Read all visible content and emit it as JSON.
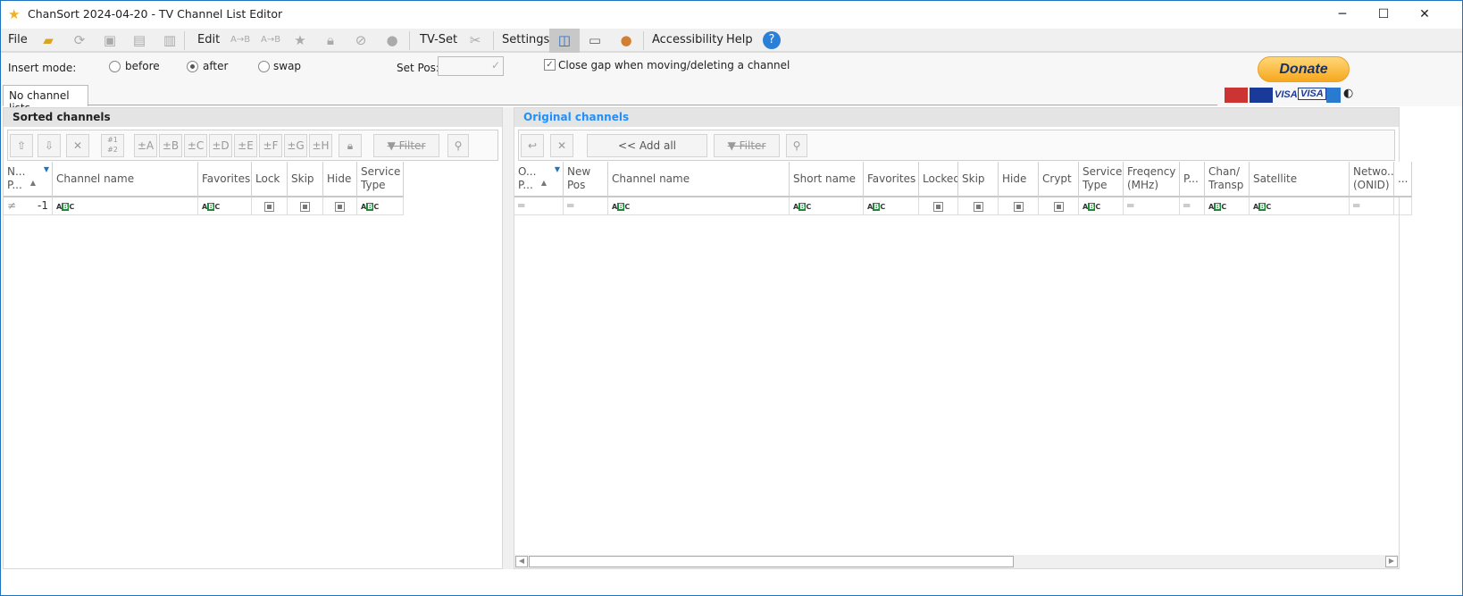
{
  "window": {
    "title": "ChanSort 2024-04-20 - TV Channel List Editor",
    "minimize": "─",
    "maximize": "☐",
    "close": "✕"
  },
  "menu": {
    "file": "File",
    "edit": "Edit",
    "tvset": "TV-Set",
    "settings": "Settings",
    "accessibility": "Accessibility",
    "help": "Help"
  },
  "options": {
    "insert_mode_label": "Insert mode:",
    "before": "before",
    "after": "after",
    "swap": "swap",
    "selected": "after",
    "set_pos_label": "Set Pos:",
    "set_pos_value": "",
    "close_gap_label": "Close gap when moving/deleting a channel",
    "close_gap_checked": true
  },
  "donate": {
    "label": "Donate",
    "cards": [
      "VISA",
      "VISA"
    ]
  },
  "tabs": [
    {
      "label": "No channel lists"
    }
  ],
  "sorted": {
    "title": "Sorted channels",
    "toolbar": {
      "fav_buttons": [
        "±A",
        "±B",
        "±C",
        "±D",
        "±E",
        "±F",
        "±G",
        "±H"
      ],
      "sort_num": "#1 #2",
      "filter": "Filter"
    },
    "columns": [
      "N... P...",
      "Channel name",
      "Favorites",
      "Lock",
      "Skip",
      "Hide",
      "Service Type"
    ],
    "row": [
      {
        "type": "text",
        "value": "≠",
        "extra": "-1"
      },
      {
        "type": "abc"
      },
      {
        "type": "abc"
      },
      {
        "type": "check"
      },
      {
        "type": "check"
      },
      {
        "type": "check"
      },
      {
        "type": "abc"
      }
    ]
  },
  "original": {
    "title": "Original channels",
    "toolbar": {
      "add_all": "<< Add all",
      "filter": "Filter"
    },
    "columns": [
      "O... P...",
      "New Pos",
      "Channel name",
      "Short name",
      "Favorites",
      "Locked",
      "Skip",
      "Hide",
      "Crypt",
      "Service Type",
      "Freqency (MHz)",
      "P...",
      "Chan/ Transp",
      "Satellite",
      "Netwo... (ONID)",
      "..."
    ],
    "row": [
      {
        "type": "text",
        "value": "═"
      },
      {
        "type": "text",
        "value": "═"
      },
      {
        "type": "abc"
      },
      {
        "type": "abc"
      },
      {
        "type": "abc"
      },
      {
        "type": "check"
      },
      {
        "type": "check"
      },
      {
        "type": "check"
      },
      {
        "type": "check"
      },
      {
        "type": "abc"
      },
      {
        "type": "text",
        "value": "═"
      },
      {
        "type": "text",
        "value": "═"
      },
      {
        "type": "abc"
      },
      {
        "type": "abc"
      },
      {
        "type": "text",
        "value": "═"
      },
      {
        "type": "text",
        "value": ""
      }
    ]
  },
  "colors": {
    "accent": "#1e73be",
    "original_title": "#1e90ff",
    "abc_green": "#1e8a3a",
    "donate": "#f7b52c"
  }
}
